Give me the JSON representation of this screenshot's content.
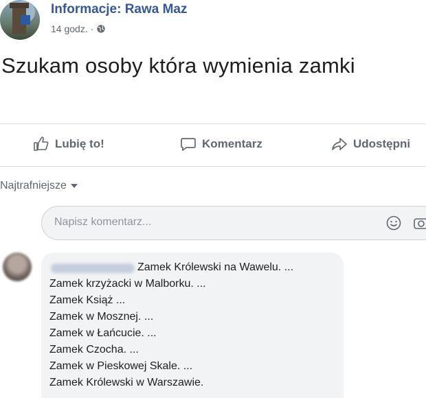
{
  "post": {
    "page_name": "Informacje: Rawa Maz",
    "time": "14 godz.",
    "separator": "·",
    "text": "Szukam osoby która wymienia zamki"
  },
  "actions": {
    "like": "Lubię to!",
    "comment": "Komentarz",
    "share": "Udostępni"
  },
  "comments_sort": {
    "label": "Najtrafniejsze"
  },
  "comment_input": {
    "placeholder": "Napisz komentarz..."
  },
  "comment": {
    "lines": [
      "Zamek Królewski na Wawelu. ...",
      "Zamek krzyżacki w Malborku. ...",
      "Zamek Książ ...",
      "Zamek w Mosznej. ...",
      "Zamek w Łańcucie. ...",
      "Zamek Czocha. ...",
      "Zamek w Pieskowej Skale. ...",
      "Zamek Królewski w Warszawie."
    ]
  },
  "colors": {
    "link_blue": "#365899",
    "muted_gray": "#606770",
    "bubble_bg": "#f2f3f5",
    "divider": "#dadde1"
  },
  "icons": {
    "like": "thumbs-up-icon",
    "comment": "speech-bubble-icon",
    "share": "share-arrow-icon",
    "privacy": "globe-icon",
    "emoji": "smiley-icon",
    "camera": "camera-icon"
  }
}
